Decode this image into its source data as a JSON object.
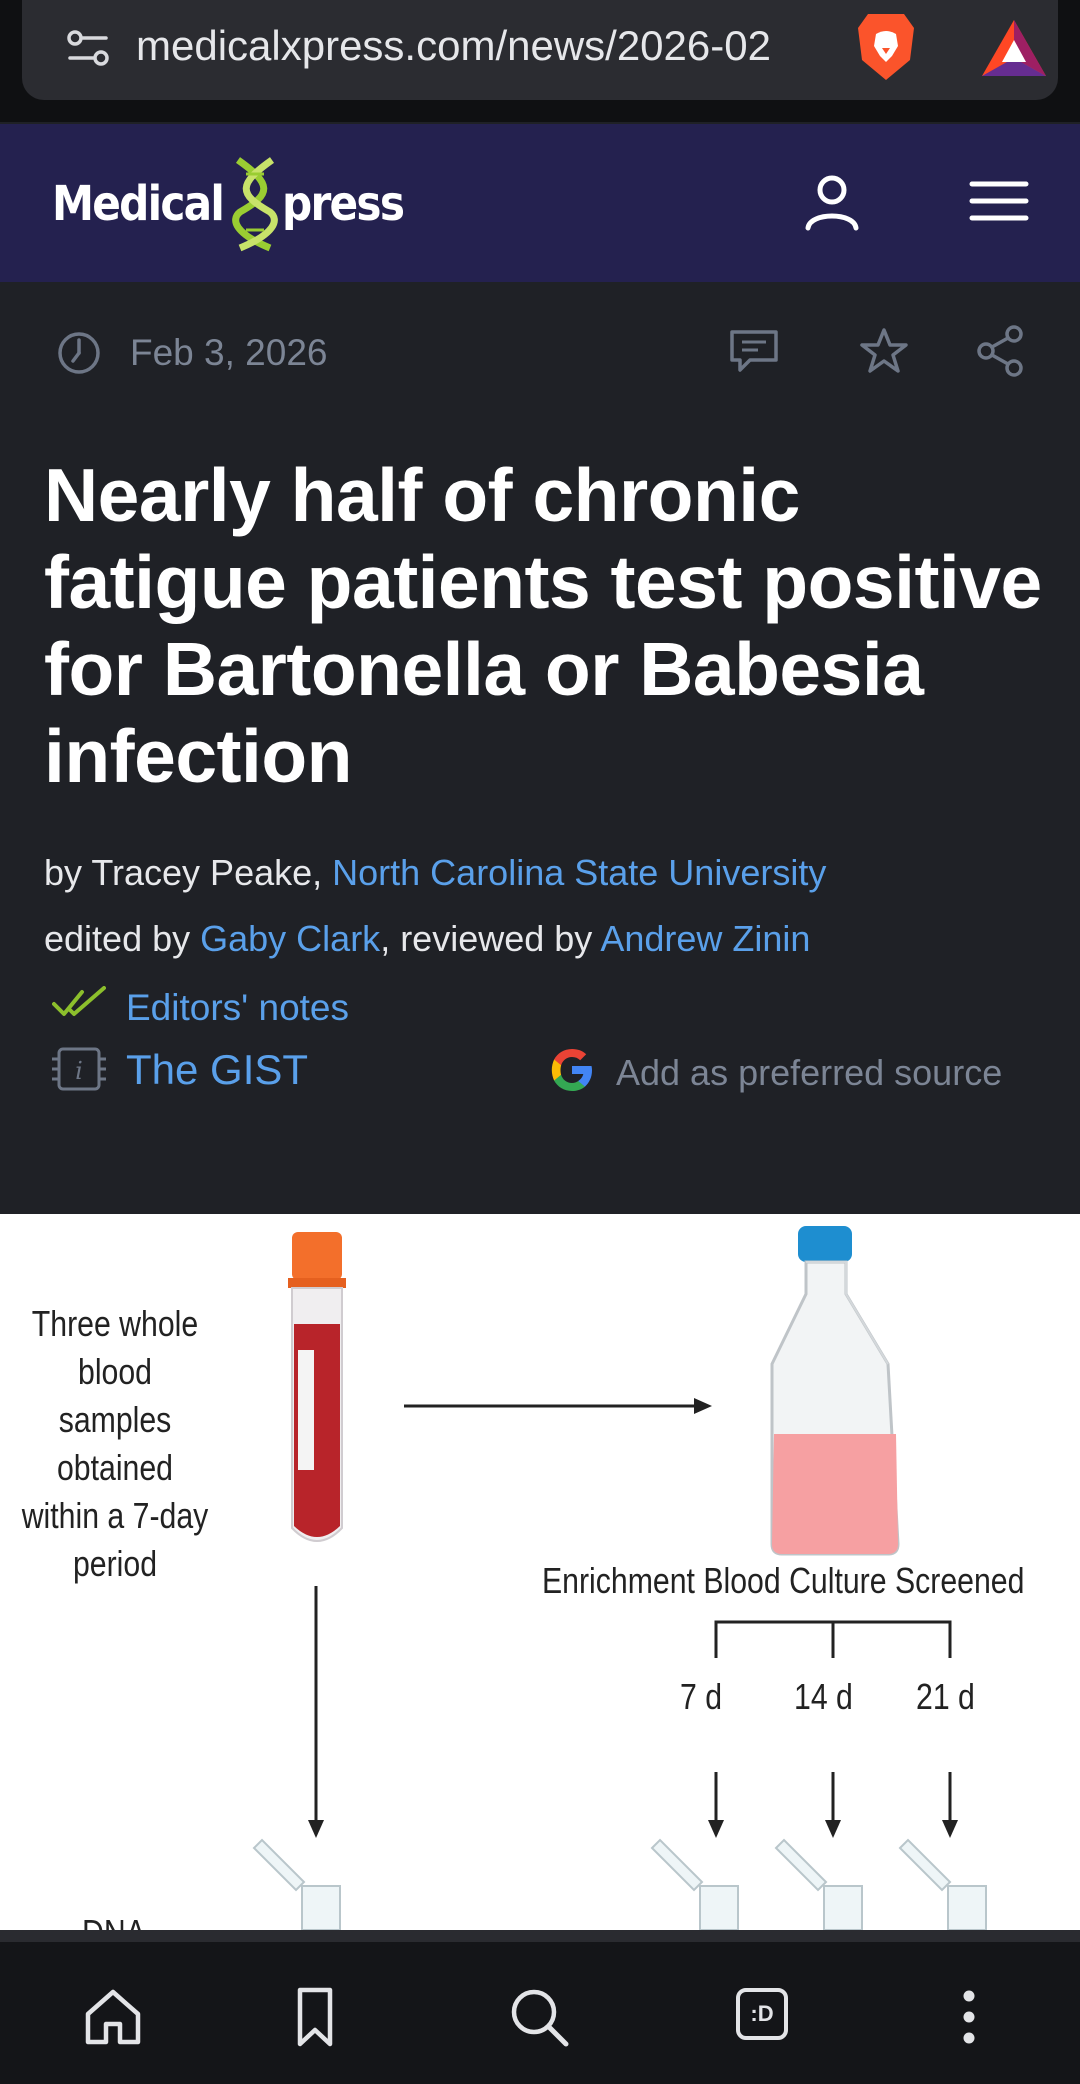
{
  "browser": {
    "url": "medicalxpress.com/news/2026-02",
    "icons": [
      "tune-icon",
      "brave-lion-icon",
      "bat-rewards-icon"
    ]
  },
  "site": {
    "logo_left": "Medical",
    "logo_right": "press",
    "icons": [
      "user-icon",
      "menu-icon"
    ],
    "colors": {
      "header_bg": "#24214f",
      "page_bg": "#1f2126",
      "link": "#5aa0ea",
      "logo_green": "#9acd32"
    }
  },
  "article": {
    "date": "Feb 3, 2026",
    "headline": "Nearly half of chronic fatigue patients test positive for Bartonella or Babesia infection",
    "byline": {
      "by": "by Tracey Peake, ",
      "institution": "North Carolina State University",
      "edited_by": "edited by ",
      "editor": "Gaby Clark",
      "reviewed_by": ", reviewed by ",
      "reviewer": "Andrew Zinin"
    },
    "editors_notes": "Editors' notes",
    "gist": "The GIST",
    "preferred_source": "Add as preferred source"
  },
  "figure": {
    "left_label": "Three whole blood samples obtained within a 7-day period",
    "culture_label": "Enrichment Blood Culture Screened",
    "day7": "7 d",
    "day14": "14 d",
    "day21": "21 d",
    "dna_label": "DNA"
  },
  "bottom_nav": {
    "icons": [
      "home-icon",
      "bookmark-icon",
      "search-icon",
      "tabs-icon",
      "more-icon"
    ],
    "tab_label": ":D"
  }
}
